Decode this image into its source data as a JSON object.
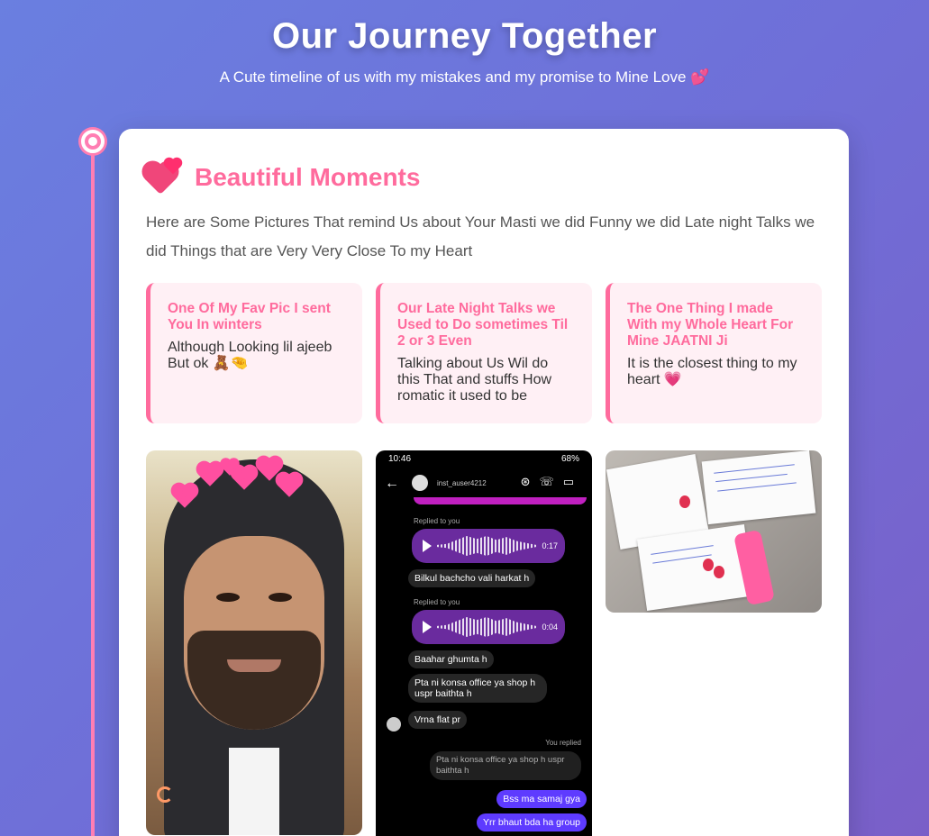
{
  "header": {
    "title": "Our Journey Together",
    "subtitle": "A Cute timeline of us with my mistakes and my promise to Mine Love 💕"
  },
  "card": {
    "title": "Beautiful Moments",
    "description": "Here are Some Pictures That remind Us about Your Masti we did Funny we did Late night Talks we did Things that are Very Very Close To my Heart",
    "notes": [
      {
        "title": "One Of My Fav Pic I sent You In winters",
        "text": "Although Looking lil ajeeb But ok 🧸🤏"
      },
      {
        "title": "Our Late Night Talks we Used to Do sometimes Til 2 or 3 Even",
        "text": "Talking about Us Wil do this That and stuffs How romatic it used to be"
      },
      {
        "title": "The One Thing I made With my Whole Heart For Mine JAATNI Ji",
        "text": "It is the closest thing to my heart 💗"
      }
    ]
  },
  "chat": {
    "time": "10:46",
    "battery": "68%",
    "username": "inst_auser4212",
    "replied_to_you": "Replied to you",
    "you_replied": "You replied",
    "voice1_duration": "0:17",
    "voice2_duration": "0:04",
    "msg1": "Bilkul bachcho vali harkat h",
    "msg2": "Baahar ghumta h",
    "msg3": "Pta ni konsa office ya shop h uspr baithta h",
    "msg4": "Vrna flat pr",
    "reply_quote": "Pta ni konsa office ya shop h uspr baithta h",
    "msg5": "Bss ma samaj gya",
    "msg6": "Yrr bhaut bda ha group"
  },
  "colors": {
    "accent": "#ff6b9d",
    "timeline": "#ff7eb3"
  }
}
